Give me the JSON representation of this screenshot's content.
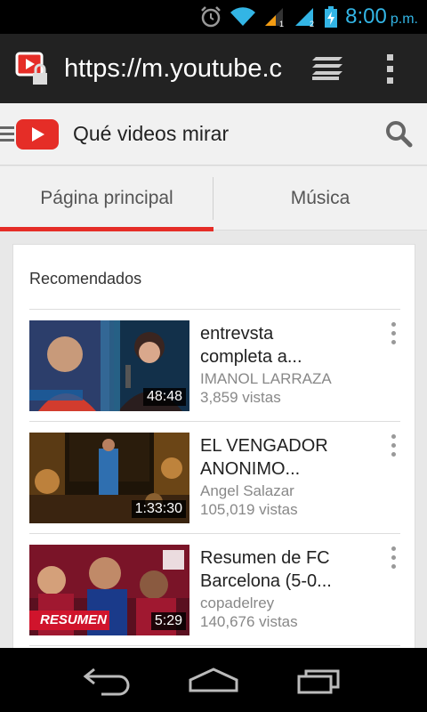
{
  "status_bar": {
    "time": "8:00",
    "ampm": "p.m.",
    "icons": [
      "alarm-icon",
      "wifi-icon",
      "signal-sim1-icon",
      "signal-sim2-icon",
      "battery-charging-icon"
    ],
    "accent_color": "#33b5e5"
  },
  "browser": {
    "url": "https://m.youtube.co",
    "icons": [
      "site-lock-icon",
      "tabs-icon",
      "overflow-menu-icon"
    ]
  },
  "header": {
    "title": "Qué videos mirar",
    "brand_color": "#e52d27"
  },
  "tabs": [
    {
      "label": "Página principal",
      "active": true
    },
    {
      "label": "Música",
      "active": false
    }
  ],
  "section": {
    "title": "Recomendados"
  },
  "videos": [
    {
      "title_line1": "entrevsta",
      "title_line2": "completa a...",
      "channel": "IMANOL LARRAZA",
      "views": "3,859 vistas",
      "duration": "48:48"
    },
    {
      "title_line1": "EL VENGADOR",
      "title_line2": "ANONIMO...",
      "channel": "Angel Salazar",
      "views": "105,019 vistas",
      "duration": "1:33:30"
    },
    {
      "title_line1": "Resumen de FC",
      "title_line2": "Barcelona (5-0...",
      "channel": "copadelrey",
      "views": "140,676 vistas",
      "duration": "5:29",
      "thumb_overlay": "RESUMEN"
    }
  ],
  "nav_bar": {
    "icons": [
      "back-icon",
      "home-icon",
      "recents-icon"
    ]
  }
}
